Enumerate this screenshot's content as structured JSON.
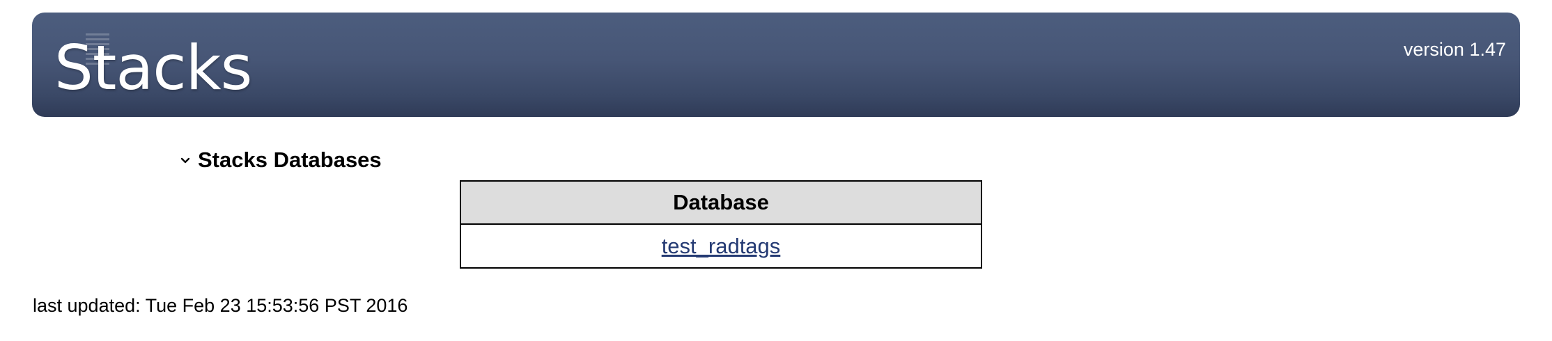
{
  "header": {
    "logo_text": "Stacks",
    "version": "version 1.47",
    "colors": {
      "banner_top": "#4c5d7e",
      "banner_bottom": "#2f3b57",
      "text": "#ffffff"
    }
  },
  "section": {
    "title": "Stacks Databases",
    "toggle_icon": "chevron-down-icon",
    "expanded": true
  },
  "table": {
    "columns": [
      "Database"
    ],
    "rows": [
      {
        "database": "test_radtags"
      }
    ],
    "colors": {
      "header_bg": "#dddddd",
      "link": "#243a73"
    }
  },
  "footer": {
    "last_updated": "last updated: Tue Feb 23 15:53:56 PST 2016"
  }
}
